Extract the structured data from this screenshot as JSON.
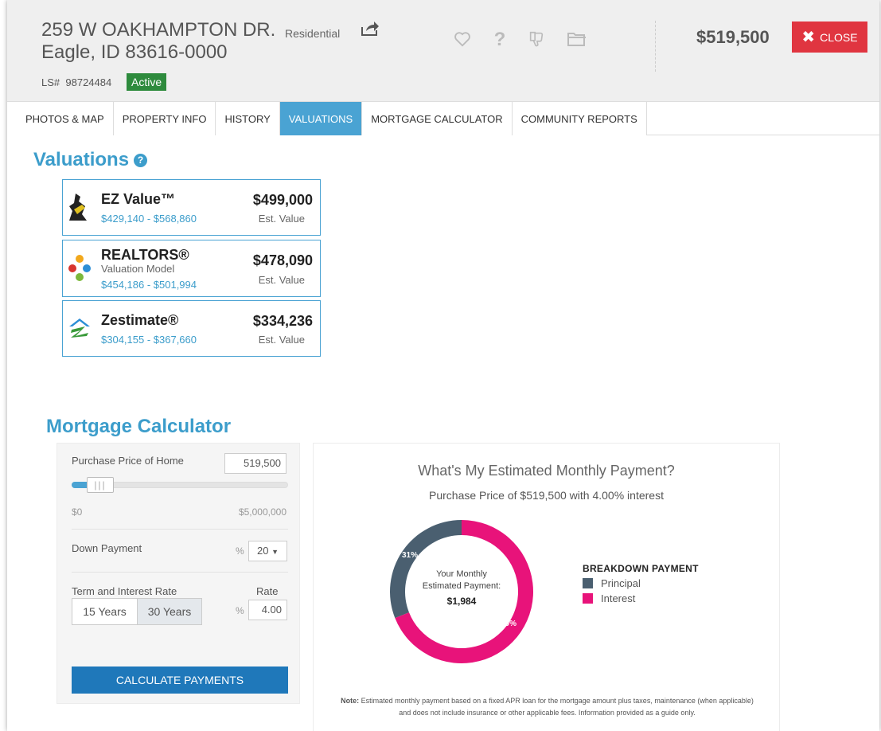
{
  "header": {
    "address_line1": "259 W OAKHAMPTON DR.",
    "property_type": "Residential",
    "address_line2": "Eagle, ID 83616-0000",
    "listing_label": "LS#",
    "listing_number": "98724484",
    "status": "Active",
    "price": "$519,500",
    "close_label": "CLOSE",
    "icons": [
      "share-icon",
      "heart-icon",
      "question-icon",
      "thumbs-down-icon",
      "folder-icon",
      "close-icon"
    ]
  },
  "tabs": [
    {
      "label": "PHOTOS & MAP",
      "active": false
    },
    {
      "label": "PROPERTY INFO",
      "active": false
    },
    {
      "label": "HISTORY",
      "active": false
    },
    {
      "label": "VALUATIONS",
      "active": true
    },
    {
      "label": "MORTGAGE CALCULATOR",
      "active": false
    },
    {
      "label": "COMMUNITY REPORTS",
      "active": false
    }
  ],
  "valuations": {
    "title": "Valuations",
    "help_glyph": "?",
    "cards": [
      {
        "name": "EZ Value™",
        "subtitle": "",
        "range": "$429,140 - $568,860",
        "amount": "$499,000",
        "est_label": "Est. Value"
      },
      {
        "name": "REALTORS®",
        "subtitle": "Valuation Model",
        "range": "$454,186 - $501,994",
        "amount": "$478,090",
        "est_label": "Est. Value"
      },
      {
        "name": "Zestimate®",
        "subtitle": "",
        "range": "$304,155 - $367,660",
        "amount": "$334,236",
        "est_label": "Est. Value"
      }
    ]
  },
  "mortgage": {
    "title": "Mortgage Calculator",
    "purchase_label": "Purchase Price of Home",
    "purchase_value": "519,500",
    "slider_min": "$0",
    "slider_max": "$5,000,000",
    "slider_fraction": 0.1039,
    "down_label": "Down Payment",
    "down_unit": "%",
    "down_value": "20",
    "term_label": "Term and Interest Rate",
    "rate_label": "Rate",
    "rate_unit": "%",
    "rate_value": "4.00",
    "term_15": "15 Years",
    "term_30": "30 Years",
    "term_selected": "30 Years",
    "calculate_label": "CALCULATE PAYMENTS"
  },
  "payment": {
    "title": "What's My Estimated Monthly Payment?",
    "subtitle": "Purchase Price of $519,500 with 4.00% interest",
    "center_line1": "Your Monthly",
    "center_line2": "Estimated Payment:",
    "center_amount": "$1,984",
    "legend_title": "BREAKDOWN PAYMENT",
    "principal_label": "Principal",
    "interest_label": "Interest",
    "principal_pct_label": "31%",
    "interest_pct_label": "69%",
    "note_bold": "Note:",
    "note_text": "Estimated monthly payment based on a fixed APR loan for the mortgage amount plus taxes, maintenance (when applicable) and does not include insurance or other applicable fees. Information provided as a guide only.",
    "colors": {
      "principal": "#4a5f70",
      "interest": "#e8137a"
    }
  },
  "chart_data": {
    "type": "pie",
    "categories": [
      "Principal",
      "Interest"
    ],
    "values": [
      31,
      69
    ],
    "title": "What's My Estimated Monthly Payment?",
    "legend": "right"
  }
}
